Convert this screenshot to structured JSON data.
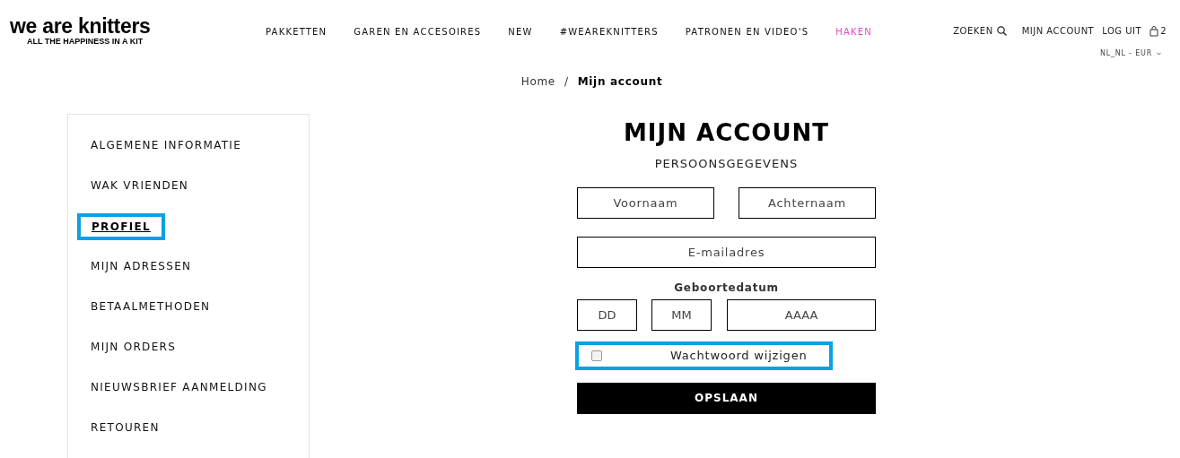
{
  "logo": {
    "name": "we are knitters",
    "tagline": "ALL THE HAPPINESS IN A KIT"
  },
  "nav": [
    {
      "label": "PAKKETTEN",
      "highlighted": false
    },
    {
      "label": "GAREN EN ACCESOIRES",
      "highlighted": false
    },
    {
      "label": "NEW",
      "highlighted": false
    },
    {
      "label": "#WEAREKNITTERS",
      "highlighted": false
    },
    {
      "label": "PATRONEN EN VIDEO'S",
      "highlighted": false
    },
    {
      "label": "HAKEN",
      "highlighted": true
    }
  ],
  "header_links": {
    "search": "ZOEKEN",
    "account": "MIJN ACCOUNT",
    "logout": "LOG UIT",
    "cart_count": "2",
    "locale": "NL_NL - EUR"
  },
  "breadcrumb": [
    {
      "label": "Home",
      "current": false
    },
    {
      "label": "Mijn account",
      "current": true
    }
  ],
  "breadcrumb_separator": "/",
  "sidebar": {
    "items": [
      {
        "label": "ALGEMENE INFORMATIE",
        "selected": false,
        "annotated": false
      },
      {
        "label": "WAK VRIENDEN",
        "selected": false,
        "annotated": false
      },
      {
        "label": "PROFIEL",
        "selected": true,
        "annotated": true
      },
      {
        "label": "MIJN ADRESSEN",
        "selected": false,
        "annotated": false
      },
      {
        "label": "BETAALMETHODEN",
        "selected": false,
        "annotated": false
      },
      {
        "label": "MIJN ORDERS",
        "selected": false,
        "annotated": false
      },
      {
        "label": "NIEUWSBRIEF AANMELDING",
        "selected": false,
        "annotated": false
      },
      {
        "label": "RETOUREN",
        "selected": false,
        "annotated": false
      }
    ]
  },
  "form": {
    "title": "MIJN ACCOUNT",
    "subtitle": "PERSOONSGEGEVENS",
    "first_name": {
      "placeholder": "Voornaam"
    },
    "last_name": {
      "placeholder": "Achternaam"
    },
    "email": {
      "placeholder": "E-mailadres"
    },
    "birthdate_label": "Geboortedatum",
    "day": {
      "placeholder": "DD"
    },
    "month": {
      "placeholder": "MM"
    },
    "year": {
      "placeholder": "AAAA"
    },
    "change_password": {
      "label": "Wachtwoord wijzigen",
      "checked": false,
      "annotated": true
    },
    "save_button": "OPSLAAN"
  }
}
